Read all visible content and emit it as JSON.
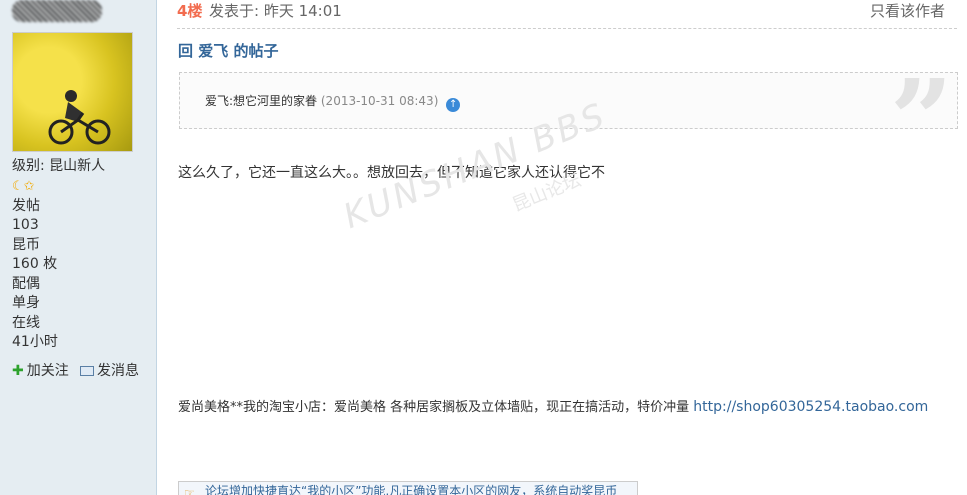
{
  "user": {
    "level_label": "级别: 昆山新人",
    "stars": "☾✩",
    "posts_label": "发帖",
    "posts_value": "103",
    "coins_label": "昆币",
    "coins_value": "160 枚",
    "spouse_label": "配偶",
    "spouse_value": "单身",
    "online_label": "在线",
    "online_value": "41小时",
    "follow_label": "加关注",
    "message_label": "发消息"
  },
  "post": {
    "floor": "4楼",
    "posted_at": "发表于: 昨天  14:01",
    "only_author": "只看该作者",
    "reply_title": "回  爱飞  的帖子",
    "quote_text": "爱飞:想它河里的家眷",
    "quote_date": "(2013-10-31 08:43)",
    "body": "这么久了，它还一直这么大。。想放回去，但不知道它家人还认得它不",
    "ad_text": "爱尚美格**我的淘宝小店：爱尚美格  各种居家搁板及立体墙贴，现正在搞活动，特价冲量",
    "ad_link": "http://shop60305254.taobao.com",
    "notice": "论坛增加快捷直达“我的小区”功能,凡正确设置本小区的网友，系统自动奖昆币"
  },
  "watermark": {
    "main": "KUNSHAN BBS",
    "sub": "昆山论坛"
  }
}
